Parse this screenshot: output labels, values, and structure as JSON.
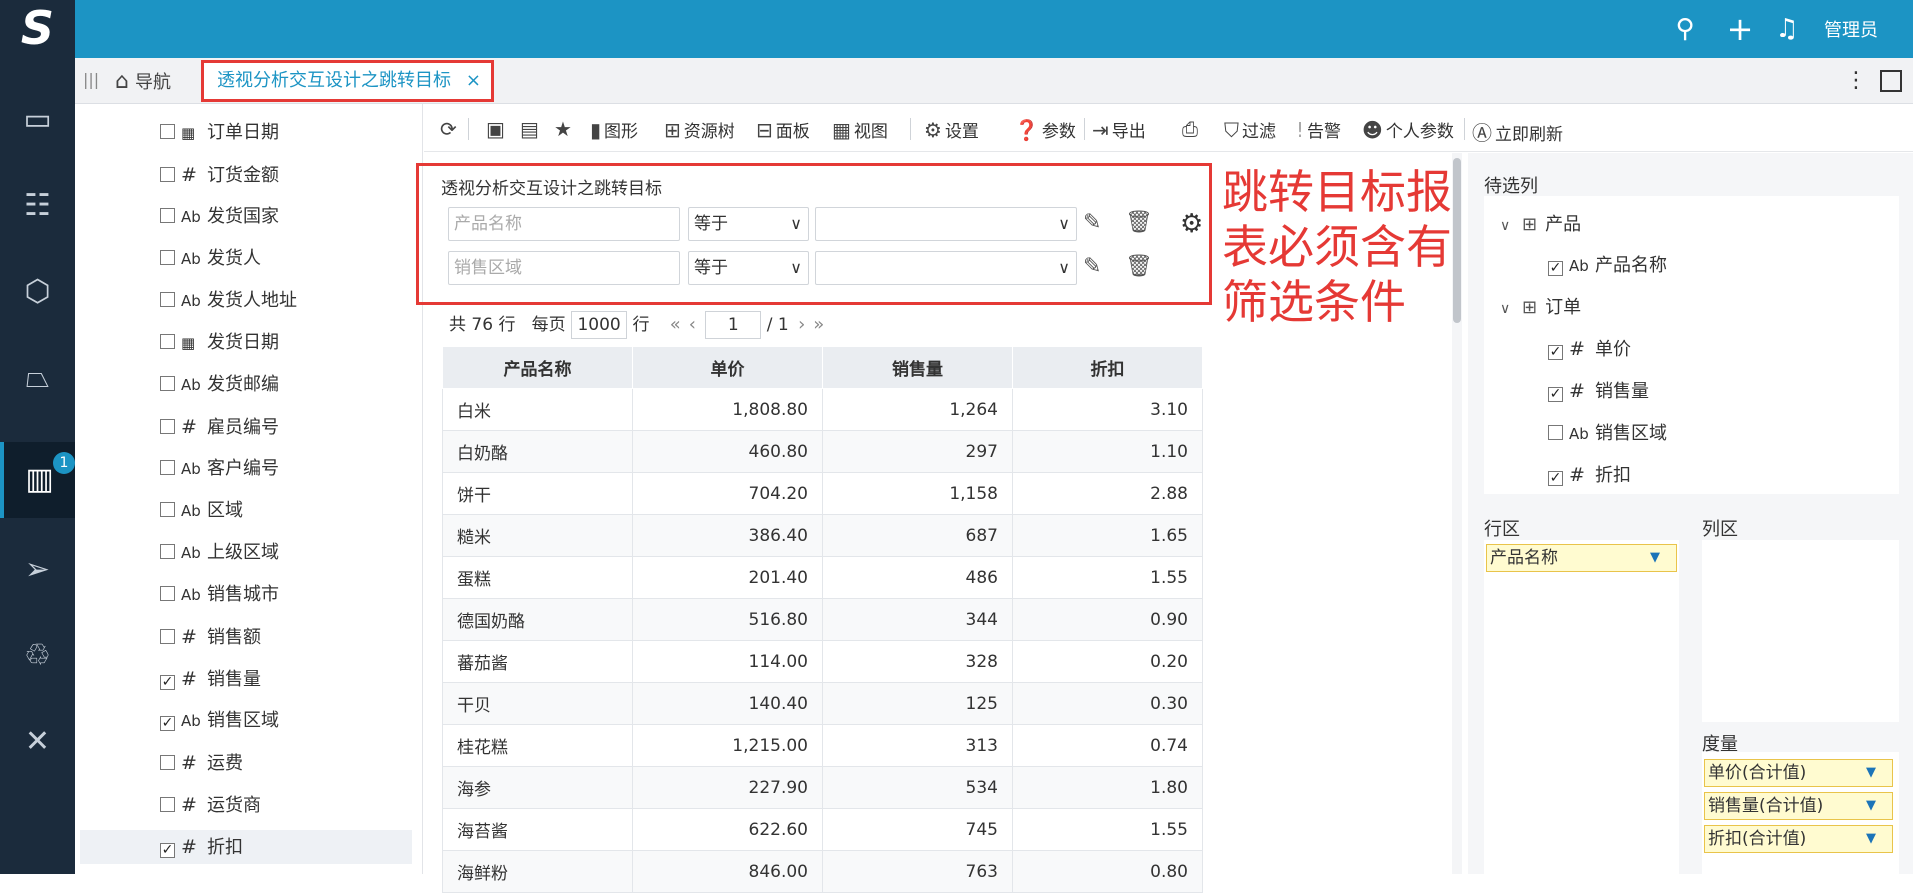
{
  "topbar": {
    "logo": "S",
    "admin": "管理员"
  },
  "leftnav": {
    "badge": "1"
  },
  "tabs": {
    "nav_label": "导航",
    "active_label": "透视分析交互设计之跳转目标",
    "close": "×"
  },
  "fields": [
    {
      "label": "订单日期",
      "type": "date",
      "checked": false
    },
    {
      "label": "订货金额",
      "type": "#",
      "checked": false
    },
    {
      "label": "发货国家",
      "type": "Ab",
      "checked": false
    },
    {
      "label": "发货人",
      "type": "Ab",
      "checked": false
    },
    {
      "label": "发货人地址",
      "type": "Ab",
      "checked": false
    },
    {
      "label": "发货日期",
      "type": "date",
      "checked": false
    },
    {
      "label": "发货邮编",
      "type": "Ab",
      "checked": false
    },
    {
      "label": "雇员编号",
      "type": "#",
      "checked": false
    },
    {
      "label": "客户编号",
      "type": "Ab",
      "checked": false
    },
    {
      "label": "区域",
      "type": "Ab",
      "checked": false
    },
    {
      "label": "上级区域",
      "type": "Ab",
      "checked": false
    },
    {
      "label": "销售城市",
      "type": "Ab",
      "checked": false
    },
    {
      "label": "销售额",
      "type": "#",
      "checked": false
    },
    {
      "label": "销售量",
      "type": "#",
      "checked": true
    },
    {
      "label": "销售区域",
      "type": "Ab",
      "checked": true
    },
    {
      "label": "运费",
      "type": "#",
      "checked": false
    },
    {
      "label": "运货商",
      "type": "#",
      "checked": false
    },
    {
      "label": "折扣",
      "type": "#",
      "checked": true
    }
  ],
  "toolbar": {
    "chart": "图形",
    "resource_tree": "资源树",
    "panel": "面板",
    "view": "视图",
    "settings": "设置",
    "params": "参数",
    "export": "导出",
    "filter": "过滤",
    "alert": "告警",
    "personal_params": "个人参数",
    "refresh": "立即刷新"
  },
  "filter": {
    "title": "透视分析交互设计之跳转目标",
    "rows": [
      {
        "field_placeholder": "产品名称",
        "op": "等于"
      },
      {
        "field_placeholder": "销售区域",
        "op": "等于"
      }
    ]
  },
  "annotation": {
    "line1": "跳转目标报",
    "line2": "表必须含有",
    "line3": "筛选条件"
  },
  "pager": {
    "total": "共 76 行",
    "per_page_label": "每页",
    "per_page": "1000",
    "row_unit": "行",
    "page": "1",
    "of": "/ 1"
  },
  "table": {
    "headers": [
      "产品名称",
      "单价",
      "销售量",
      "折扣"
    ],
    "rows": [
      [
        "白米",
        "1,808.80",
        "1,264",
        "3.10"
      ],
      [
        "白奶酪",
        "460.80",
        "297",
        "1.10"
      ],
      [
        "饼干",
        "704.20",
        "1,158",
        "2.88"
      ],
      [
        "糙米",
        "386.40",
        "687",
        "1.65"
      ],
      [
        "蛋糕",
        "201.40",
        "486",
        "1.55"
      ],
      [
        "德国奶酪",
        "516.80",
        "344",
        "0.90"
      ],
      [
        "蕃茄酱",
        "114.00",
        "328",
        "0.20"
      ],
      [
        "干贝",
        "140.40",
        "125",
        "0.30"
      ],
      [
        "桂花糕",
        "1,215.00",
        "313",
        "0.74"
      ],
      [
        "海参",
        "227.90",
        "534",
        "1.80"
      ],
      [
        "海苔酱",
        "622.60",
        "745",
        "1.55"
      ],
      [
        "海鲜粉",
        "846.00",
        "763",
        "0.80"
      ]
    ]
  },
  "right": {
    "candidates_label": "待选列",
    "tree": {
      "product": "产品",
      "product_name": "产品名称",
      "order": "订单",
      "unit_price": "单价",
      "sales_qty": "销售量",
      "sales_region": "销售区域",
      "discount": "折扣"
    },
    "row_area_label": "行区",
    "col_area_label": "列区",
    "measure_label": "度量",
    "row_pill": "产品名称",
    "measures": [
      "单价(合计值)",
      "销售量(合计值)",
      "折扣(合计值)"
    ]
  }
}
